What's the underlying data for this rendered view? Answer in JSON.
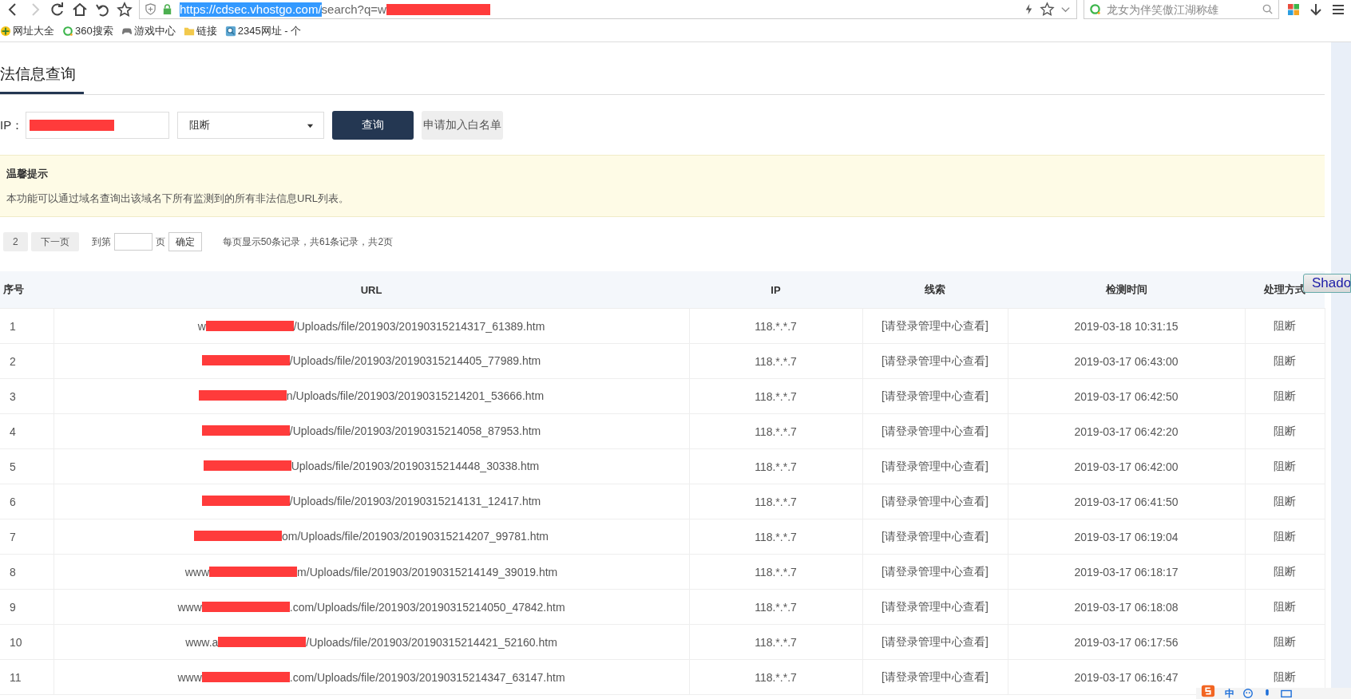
{
  "browser": {
    "url_host": "https://cdsec.vhostgo.com/",
    "url_path": "search?q=w",
    "search_placeholder": "龙女为伴笑傲江湖称雄"
  },
  "bookmarks": [
    {
      "label": "网址大全",
      "kind": "globe"
    },
    {
      "label": "360搜索",
      "kind": "ring"
    },
    {
      "label": "游戏中心",
      "kind": "gamepad"
    },
    {
      "label": "链接",
      "kind": "folder"
    },
    {
      "label": "2345网址 - 个",
      "kind": "magnifier"
    }
  ],
  "page": {
    "tab": "法信息查询",
    "ip_label": "IP：",
    "mode": "阻断",
    "query_button": "查询",
    "whitelist_button": "申请加入白名单"
  },
  "notice": {
    "title": "温馨提示",
    "text": "本功能可以通过域名查询出该域名下所有监测到的所有非法信息URL列表。"
  },
  "pager": {
    "page_label": "2",
    "next": "下一页",
    "goto_label": "到第",
    "page_unit": "页",
    "confirm": "确定",
    "summary": "每页显示50条记录，共61条记录，共2页"
  },
  "table": {
    "columns": [
      "序号",
      "URL",
      "IP",
      "线索",
      "检测时间",
      "处理方式"
    ],
    "rows": [
      {
        "no": "1",
        "url_start": "w",
        "url_end": "/Uploads/file/201903/20190315214317_61389.htm",
        "ip": "118.*.*.7",
        "clue": "[请登录管理中心查看]",
        "time": "2019-03-18 10:31:15",
        "action": "阻断"
      },
      {
        "no": "2",
        "url_start": "",
        "url_end": "/Uploads/file/201903/20190315214405_77989.htm",
        "ip": "118.*.*.7",
        "clue": "[请登录管理中心查看]",
        "time": "2019-03-17 06:43:00",
        "action": "阻断"
      },
      {
        "no": "3",
        "url_start": "",
        "url_end": "n/Uploads/file/201903/20190315214201_53666.htm",
        "ip": "118.*.*.7",
        "clue": "[请登录管理中心查看]",
        "time": "2019-03-17 06:42:50",
        "action": "阻断"
      },
      {
        "no": "4",
        "url_start": "",
        "url_end": "/Uploads/file/201903/20190315214058_87953.htm",
        "ip": "118.*.*.7",
        "clue": "[请登录管理中心查看]",
        "time": "2019-03-17 06:42:20",
        "action": "阻断"
      },
      {
        "no": "5",
        "url_start": "",
        "url_end": "Uploads/file/201903/20190315214448_30338.htm",
        "ip": "118.*.*.7",
        "clue": "[请登录管理中心查看]",
        "time": "2019-03-17 06:42:00",
        "action": "阻断"
      },
      {
        "no": "6",
        "url_start": "",
        "url_end": "/Uploads/file/201903/20190315214131_12417.htm",
        "ip": "118.*.*.7",
        "clue": "[请登录管理中心查看]",
        "time": "2019-03-17 06:41:50",
        "action": "阻断"
      },
      {
        "no": "7",
        "url_start": "",
        "url_end": "om/Uploads/file/201903/20190315214207_99781.htm",
        "ip": "118.*.*.7",
        "clue": "[请登录管理中心查看]",
        "time": "2019-03-17 06:19:04",
        "action": "阻断"
      },
      {
        "no": "8",
        "url_start": "www",
        "url_end": "m/Uploads/file/201903/20190315214149_39019.htm",
        "ip": "118.*.*.7",
        "clue": "[请登录管理中心查看]",
        "time": "2019-03-17 06:18:17",
        "action": "阻断"
      },
      {
        "no": "9",
        "url_start": "www",
        "url_end": ".com/Uploads/file/201903/20190315214050_47842.htm",
        "ip": "118.*.*.7",
        "clue": "[请登录管理中心查看]",
        "time": "2019-03-17 06:18:08",
        "action": "阻断"
      },
      {
        "no": "10",
        "url_start": "www.a",
        "url_end": "/Uploads/file/201903/20190315214421_52160.htm",
        "ip": "118.*.*.7",
        "clue": "[请登录管理中心查看]",
        "time": "2019-03-17 06:17:56",
        "action": "阻断"
      },
      {
        "no": "11",
        "url_start": "www",
        "url_end": ".com/Uploads/file/201903/20190315214347_63147.htm",
        "ip": "118.*.*.7",
        "clue": "[请登录管理中心查看]",
        "time": "2019-03-17 06:16:47",
        "action": "阻断"
      }
    ]
  },
  "overlay_button": "Shado",
  "ime": {
    "label": "中"
  }
}
